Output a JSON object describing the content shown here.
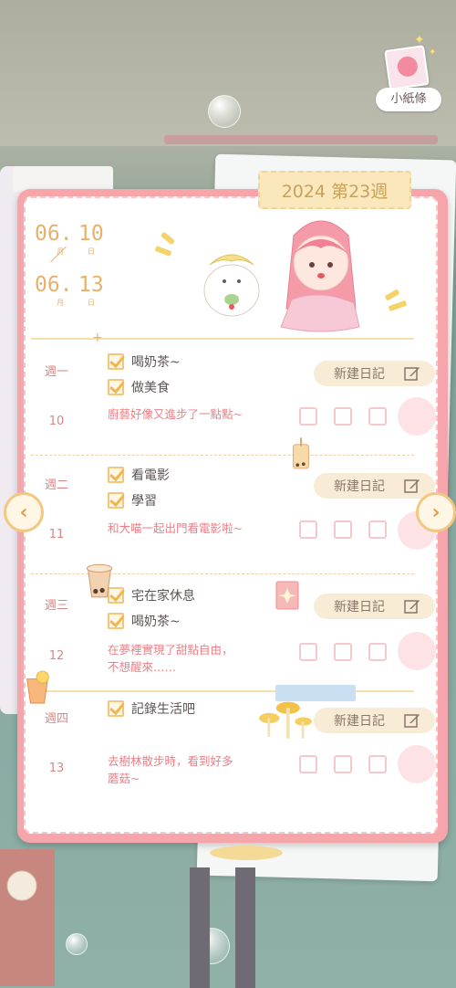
{
  "header": {
    "week_tag": "2024 第23週",
    "mini_note_label": "小紙條"
  },
  "date_range": {
    "start_month": "06.",
    "start_day": "10",
    "end_month": "06.",
    "end_day": "13",
    "month_unit": "月",
    "day_unit": "日"
  },
  "days": [
    {
      "weekday": "週一",
      "date": "10",
      "todos": [
        "喝奶茶~",
        "做美食"
      ],
      "note": "廚藝好像又進步了一點點~",
      "new_entry_label": "新建日記"
    },
    {
      "weekday": "週二",
      "date": "11",
      "todos": [
        "看電影",
        "學習"
      ],
      "note": "和大喵一起出門看電影啦~",
      "new_entry_label": "新建日記"
    },
    {
      "weekday": "週三",
      "date": "12",
      "todos": [
        "宅在家休息",
        "喝奶茶~"
      ],
      "note_lines": [
        "在夢裡實現了甜點自由，",
        "不想醒來……"
      ],
      "new_entry_label": "新建日記"
    },
    {
      "weekday": "週四",
      "date": "13",
      "todos": [
        "記錄生活吧"
      ],
      "note_lines": [
        "去樹林散步時，看到好多",
        "蘑菇~"
      ],
      "new_entry_label": "新建日記"
    }
  ],
  "nav": {
    "prev_icon": "chevron-left-icon",
    "next_icon": "chevron-right-icon",
    "prev_glyph": "‹",
    "next_glyph": "›"
  },
  "colors": {
    "frame": "#f6a6ab",
    "accent_gold": "#e7b16a",
    "note_pink": "#ec7f86",
    "button_bg": "#f8ecd6"
  }
}
